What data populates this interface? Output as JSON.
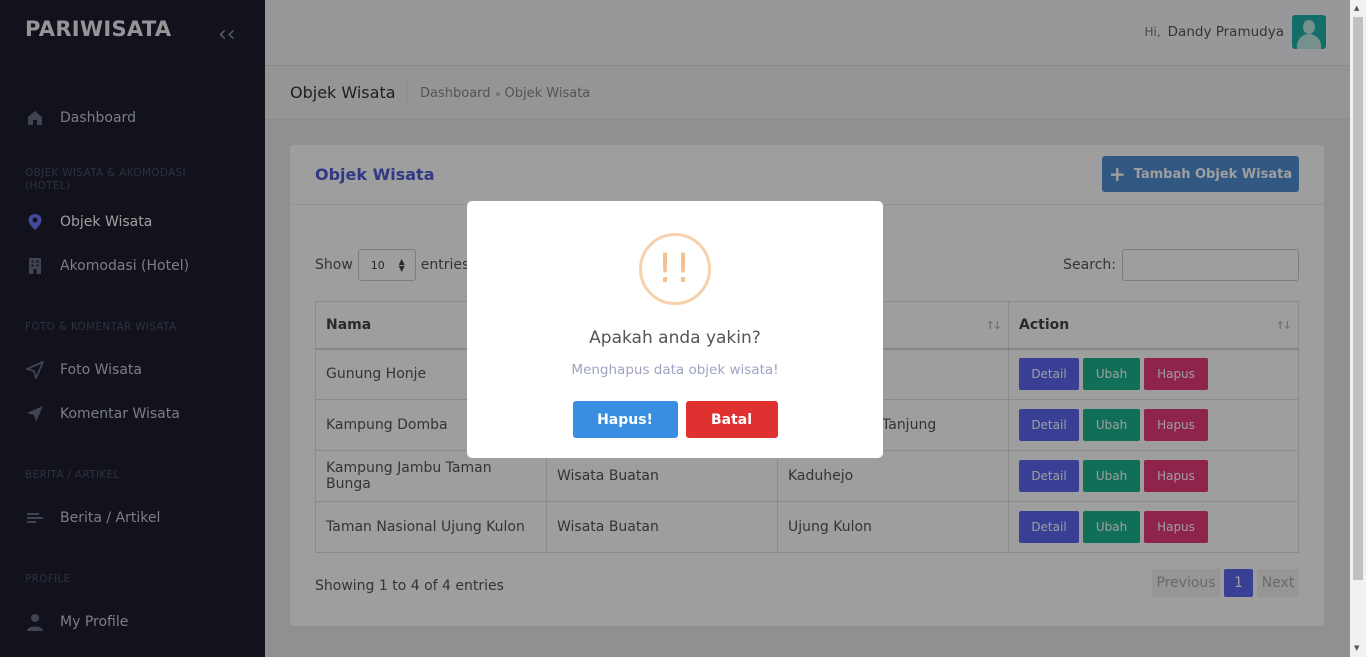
{
  "sidebar": {
    "brand": "PARIWISATA",
    "items": [
      {
        "label": "Dashboard",
        "icon": "home-icon"
      },
      {
        "label": "Objek Wisata",
        "icon": "map-pin-icon"
      },
      {
        "label": "Akomodasi (Hotel)",
        "icon": "building-icon"
      },
      {
        "label": "Foto Wisata",
        "icon": "send-icon"
      },
      {
        "label": "Komentar Wisata",
        "icon": "send-icon"
      },
      {
        "label": "Berita / Artikel",
        "icon": "list-icon"
      },
      {
        "label": "My Profile",
        "icon": "user-icon"
      }
    ],
    "sections": [
      "OBJEK WISATA & AKOMODASI (HOTEL)",
      "FOTO & KOMENTAR WISATA",
      "BERITA / ARTIKEL",
      "PROFILE"
    ]
  },
  "header": {
    "hi": "Hi,",
    "username": "Dandy Pramudya"
  },
  "subheader": {
    "title": "Objek Wisata",
    "breadcrumb": [
      "Dashboard",
      "Objek Wisata"
    ]
  },
  "card": {
    "title": "Objek Wisata",
    "add_button": "Tambah Objek Wisata",
    "show_label": "Show",
    "entries_value": "10",
    "entries_label": "entries",
    "search_label": "Search:",
    "columns": [
      "Nama",
      "",
      "",
      "Action"
    ],
    "rows": [
      {
        "nama": "Gunung Honje",
        "jenis": "",
        "lokasi": ""
      },
      {
        "nama": "Kampung Domba",
        "jenis": "",
        "lokasi": "Tanjung"
      },
      {
        "nama": "Kampung Jambu Taman Bunga",
        "jenis": "Wisata Buatan",
        "lokasi": "Kaduhejo"
      },
      {
        "nama": "Taman Nasional Ujung Kulon",
        "jenis": "Wisata Buatan",
        "lokasi": "Ujung Kulon"
      }
    ],
    "actions": {
      "detail": "Detail",
      "ubah": "Ubah",
      "hapus": "Hapus"
    },
    "info": "Showing 1 to 4 of 4 entries",
    "pagination": {
      "previous": "Previous",
      "page": "1",
      "next": "Next"
    }
  },
  "modal": {
    "icon": "!!",
    "title": "Apakah anda yakin?",
    "text": "Menghapus data objek wisata!",
    "confirm": "Hapus!",
    "cancel": "Batal"
  },
  "colors": {
    "sidebar_bg": "#1c1d2c",
    "accent": "#5b67ef",
    "success": "#1cb28d",
    "danger": "#e63b7a",
    "primary_button": "#3a8ee2",
    "cancel_button": "#e03131"
  }
}
